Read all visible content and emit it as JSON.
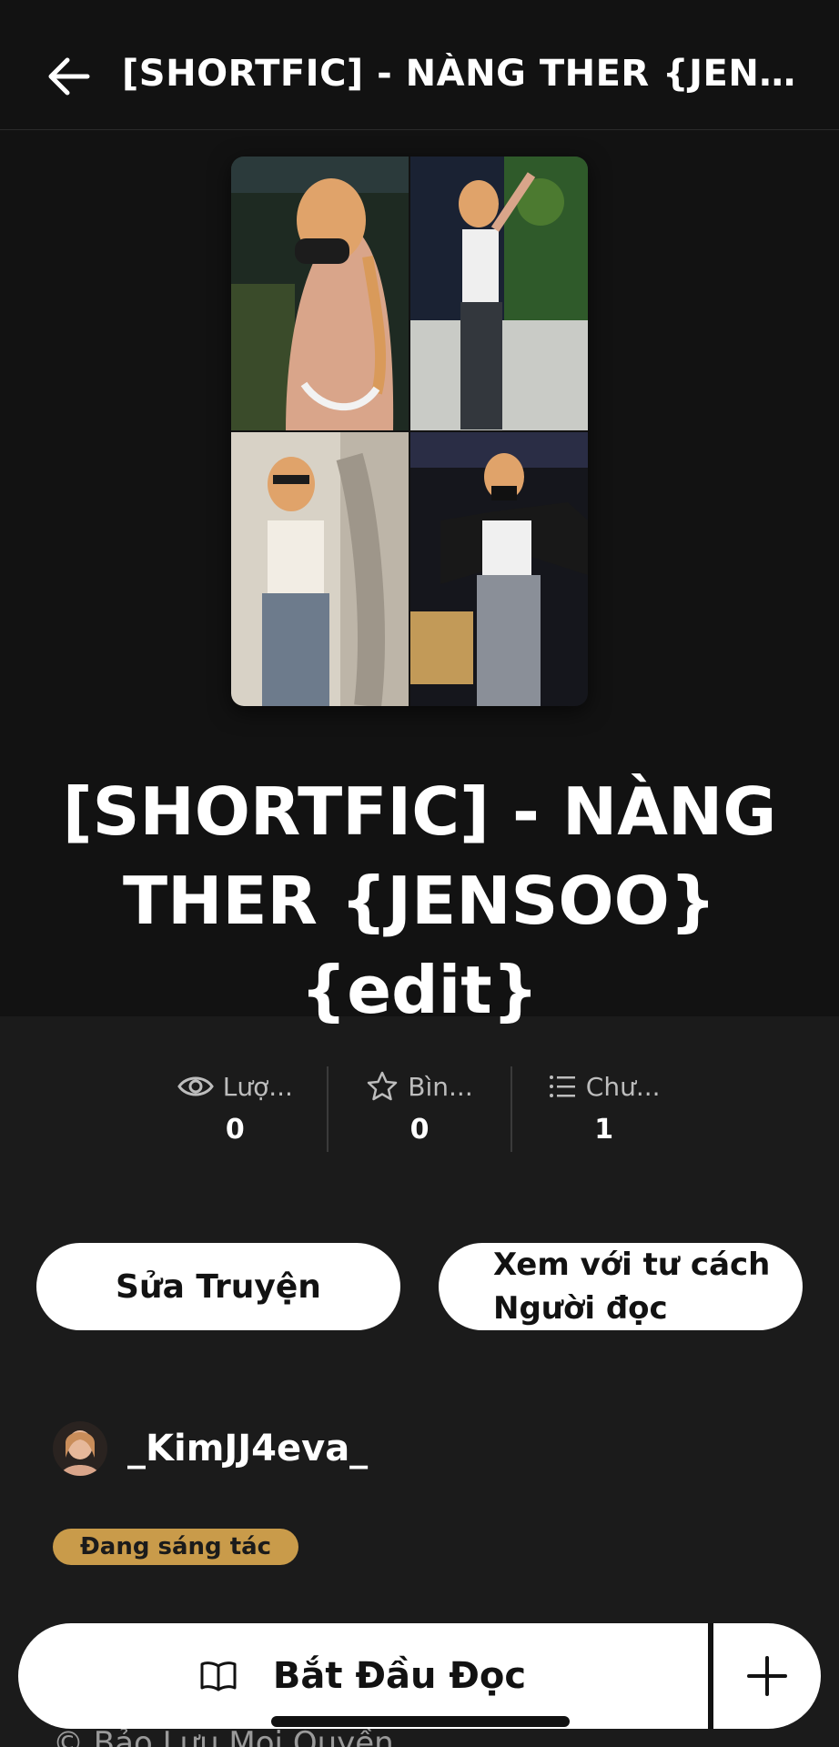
{
  "header": {
    "back_icon": "arrow-left-icon",
    "title": "[SHORTFIC] - NÀNG THER {JENSO..."
  },
  "story": {
    "title_line1": "[SHORTFIC] - NÀNG",
    "title_line2": "THER {JENSOO}{edit}"
  },
  "stats": [
    {
      "icon": "eye-icon",
      "label": "Lượ...",
      "value": "0"
    },
    {
      "icon": "star-icon",
      "label": "Bìn...",
      "value": "0"
    },
    {
      "icon": "list-icon",
      "label": "Chư...",
      "value": "1"
    }
  ],
  "actions": {
    "edit_label": "Sửa Truyện",
    "view_line1": "Xem với tư cách",
    "view_line2": "Người đọc"
  },
  "author": {
    "name": "_KimJJ4eva_"
  },
  "status_badge": "Đang sáng tác",
  "copyright": "© Bảo Lưu Mọi Quyền",
  "bottom": {
    "read_label": "Bắt Đầu Đọc",
    "book_icon": "book-open-icon",
    "plus_icon": "plus-icon"
  },
  "colors": {
    "background": "#1b1b1b",
    "header_bg": "#121212",
    "badge": "#c99b4a"
  }
}
